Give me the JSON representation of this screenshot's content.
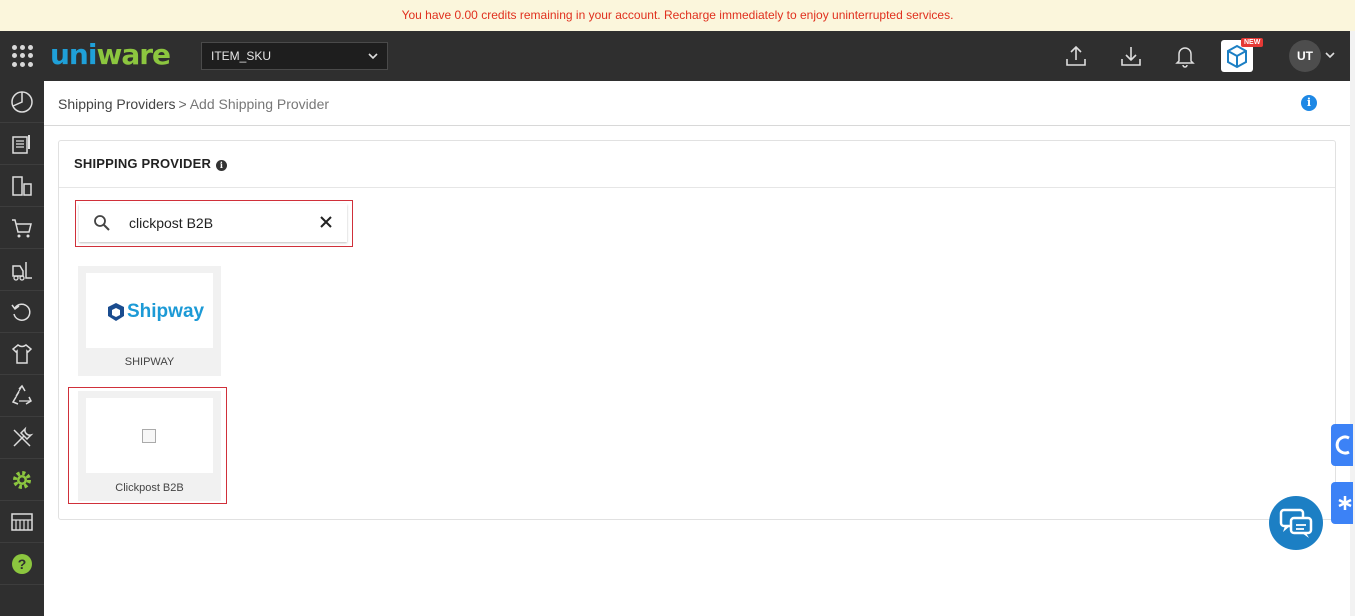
{
  "banner": {
    "message": "You have 0.00 credits remaining in your account. Recharge immediately to enjoy uninterrupted services."
  },
  "topbar": {
    "logo_part1": "uni",
    "logo_part2": "ware",
    "sku_select": {
      "value": "ITEM_SKU"
    },
    "new_badge": "NEW",
    "avatar_initials": "UT"
  },
  "sidebar": {
    "items": [
      "dashboard-icon",
      "orders-icon",
      "products-icon",
      "cart-icon",
      "forklift-icon",
      "returns-icon",
      "shirt-icon",
      "recycle-icon",
      "tools-icon",
      "settings-gear-icon",
      "barcode-icon",
      "help-icon"
    ]
  },
  "breadcrumb": {
    "parent": "Shipping Providers",
    "separator": ">",
    "current": "Add Shipping Provider"
  },
  "card": {
    "title": "SHIPPING PROVIDER",
    "search": {
      "value": "clickpost B2B",
      "placeholder": ""
    },
    "providers": [
      {
        "logo_text": "Shipway",
        "label": "SHIPWAY"
      },
      {
        "logo_text": "",
        "label": "Clickpost B2B"
      }
    ]
  },
  "colors": {
    "banner_bg": "#fbf6dc",
    "banner_text": "#e0301e",
    "topbar_bg": "#2f2f2f",
    "accent_blue": "#1e88e5",
    "selection_red": "#d0303a",
    "settings_green": "#8cc63f"
  }
}
